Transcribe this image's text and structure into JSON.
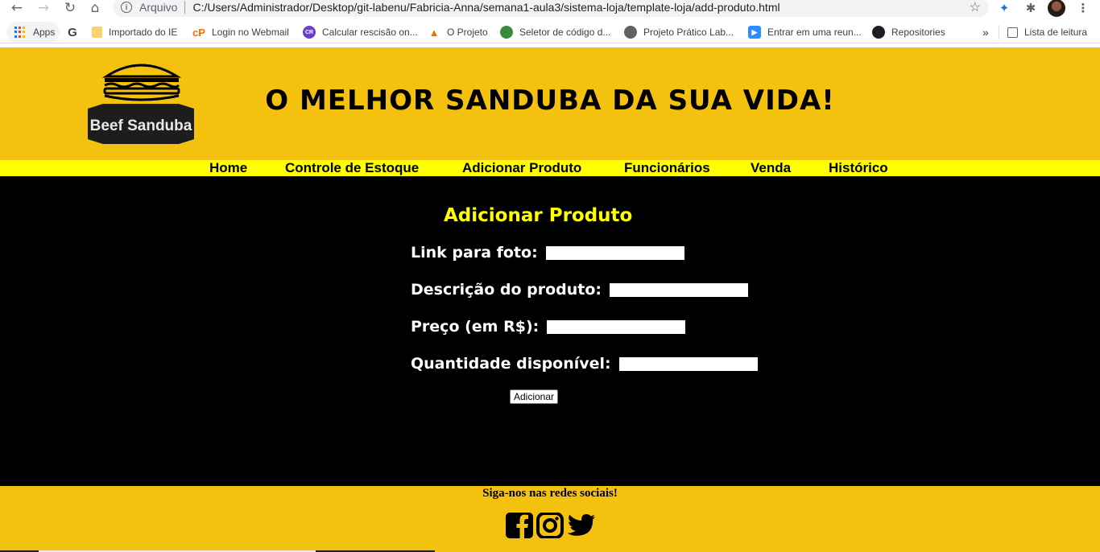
{
  "browser": {
    "scheme_label": "Arquivo",
    "url": "C:/Users/Administrador/Desktop/git-labenu/Fabricia-Anna/semana1-aula3/sistema-loja/template-loja/add-produto.html",
    "bookmarks": [
      {
        "label": "Apps",
        "icon": "apps-grid-icon"
      },
      {
        "label": "Importado do IE",
        "icon": "folder-icon"
      },
      {
        "label": "Login no Webmail",
        "icon": "webmail-icon"
      },
      {
        "label": "Calcular rescisão on...",
        "icon": "calculator-icon"
      },
      {
        "label": "O Projeto",
        "icon": "project-icon"
      },
      {
        "label": "Seletor de código d...",
        "icon": "selector-icon"
      },
      {
        "label": "Projeto Prático Lab...",
        "icon": "globe-icon"
      },
      {
        "label": "Entrar em uma reun...",
        "icon": "zoom-icon"
      },
      {
        "label": "Repositories",
        "icon": "github-icon"
      }
    ],
    "overflow_label": "»",
    "reading_list_label": "Lista de leitura"
  },
  "header": {
    "logo_text": "Beef Sanduba",
    "headline": "O MELHOR SANDUBA DA SUA VIDA!"
  },
  "nav": {
    "items": [
      "Home",
      "Controle de Estoque",
      "Adicionar Produto",
      "Funcionários",
      "Venda",
      "Histórico"
    ]
  },
  "form": {
    "title": "Adicionar Produto",
    "fields": [
      {
        "label": "Link para foto:",
        "value": ""
      },
      {
        "label": "Descrição do produto:",
        "value": ""
      },
      {
        "label": "Preço (em R$):",
        "value": ""
      },
      {
        "label": "Quantidade disponível:",
        "value": ""
      }
    ],
    "submit_label": "Adicionar"
  },
  "footer": {
    "text": "Siga-nos nas redes sociais!",
    "social_icons": [
      "facebook-icon",
      "instagram-icon",
      "twitter-icon"
    ]
  },
  "colors": {
    "header_bg": "#f5c10f",
    "menu_bg": "#ffff00",
    "main_bg": "#000000",
    "title_color": "#ffff00"
  }
}
